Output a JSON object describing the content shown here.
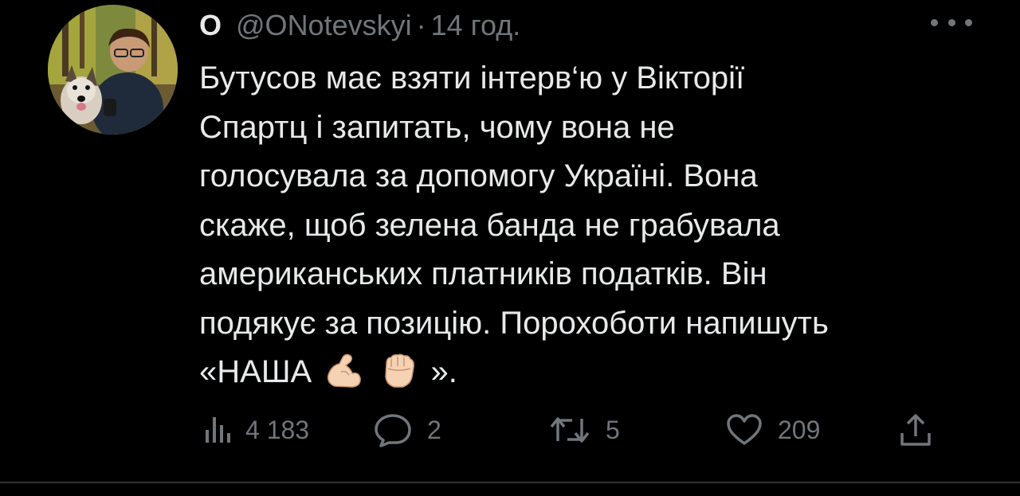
{
  "tweet": {
    "display_name": "О",
    "handle": "@ONotevskyi",
    "separator": "·",
    "time": "14 год.",
    "text_lines": [
      "Бутусов має взяти інтерв‘ю у Вікторії",
      "Спартц і запитать, чому вона не",
      "голосувала за допомогу Україні. Вона",
      "скаже, щоб зелена банда не грабувала",
      "американських платників податків. Він",
      "подякує за позицію. Порохоботи напишуть"
    ],
    "last_line_prefix": "«НАША",
    "last_line_suffix": "».",
    "emojis": [
      "flexed-biceps",
      "raised-fist"
    ]
  },
  "actions": {
    "views": "4 183",
    "replies": "2",
    "retweets": "5",
    "likes": "209"
  },
  "colors": {
    "background": "#000000",
    "text": "#e7e9ea",
    "secondary": "#71767b",
    "divider": "#2f3336"
  },
  "icons": [
    "views-icon",
    "reply-icon",
    "retweet-icon",
    "like-icon",
    "share-icon",
    "more-icon"
  ]
}
